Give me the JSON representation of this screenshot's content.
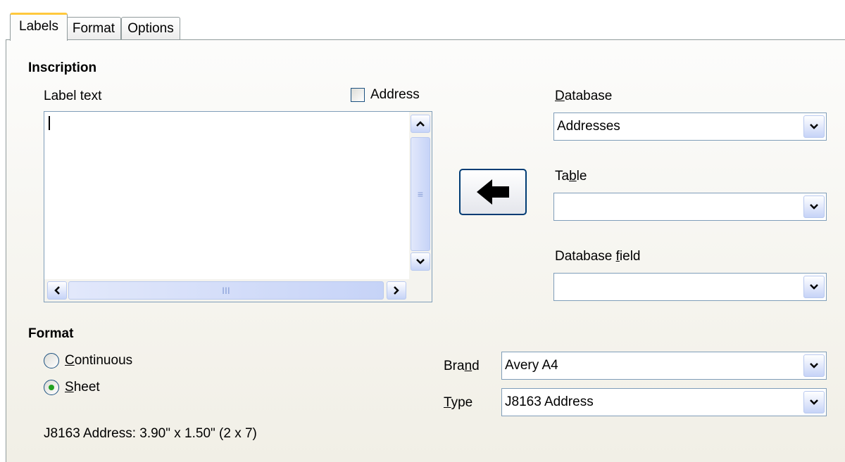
{
  "tabs": [
    {
      "label": "Labels",
      "active": true
    },
    {
      "label": "Format",
      "active": false
    },
    {
      "label": "Options",
      "active": false
    }
  ],
  "inscription": {
    "heading": "Inscription",
    "label_text_label": "Label text",
    "address_checkbox": {
      "label": "Address",
      "checked": false
    },
    "label_text_value": "",
    "scroll_grip_vertical": "≡",
    "scroll_grip_horizontal": "III"
  },
  "database": {
    "database_label": "Database",
    "database_value": "Addresses",
    "table_label": "Table",
    "table_value": "",
    "field_label": "Database field",
    "field_value": ""
  },
  "insert_button": {
    "icon": "arrow-left-icon"
  },
  "format": {
    "heading": "Format",
    "continuous_label": "Continuous",
    "sheet_label": "Sheet",
    "selected": "Sheet",
    "brand_label": "Brand",
    "brand_value": "Avery A4",
    "type_label": "Type",
    "type_value": "J8163 Address",
    "summary": "J8163 Address: 3.90\" x 1.50\" (2 x 7)"
  }
}
